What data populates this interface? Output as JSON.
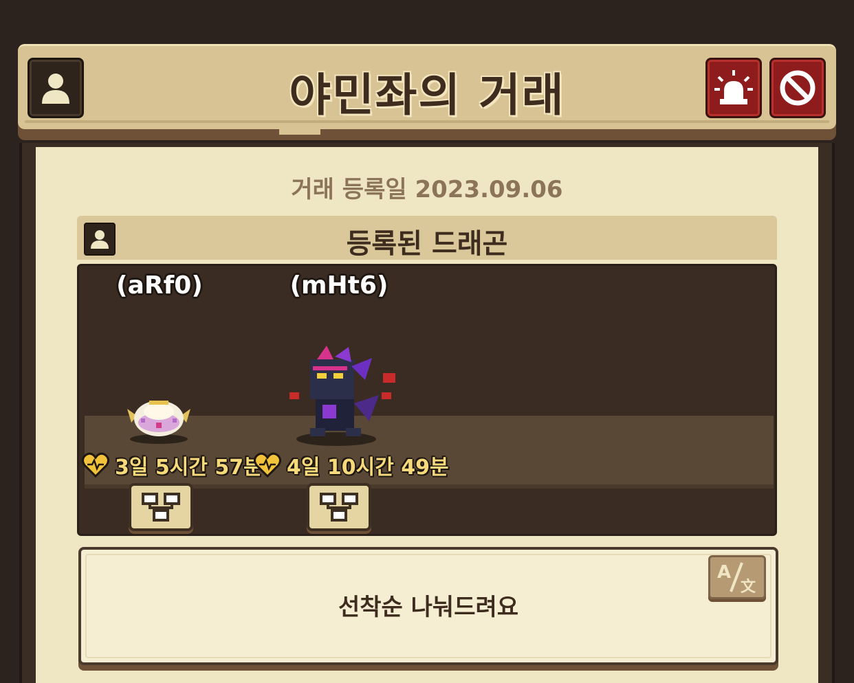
{
  "header": {
    "title": "야민좌의 거래",
    "profile_icon": "person-icon",
    "alarm_icon": "siren-icon",
    "block_icon": "prohibited-icon"
  },
  "trade": {
    "registration_date": "거래 등록일 2023.09.06",
    "section_title": "등록된 드래곤",
    "dragons": [
      {
        "name": "(aRf0)",
        "timer": "3일 5시간 57분",
        "sprite": "egg-sprite"
      },
      {
        "name": "(mHt6)",
        "timer": "4일 10시간 49분",
        "sprite": "dragon-sprite"
      }
    ]
  },
  "memo": {
    "text": "선착순 나눠드려요",
    "translate_icon": "translate-icon"
  },
  "colors": {
    "banner": "#d7c393",
    "panel": "#efe6c4",
    "title_text": "#3e2c1f",
    "alert_red": "#8f1c1c",
    "timer_gold": "#f6d97a",
    "heart_gold": "#f2c23a"
  }
}
